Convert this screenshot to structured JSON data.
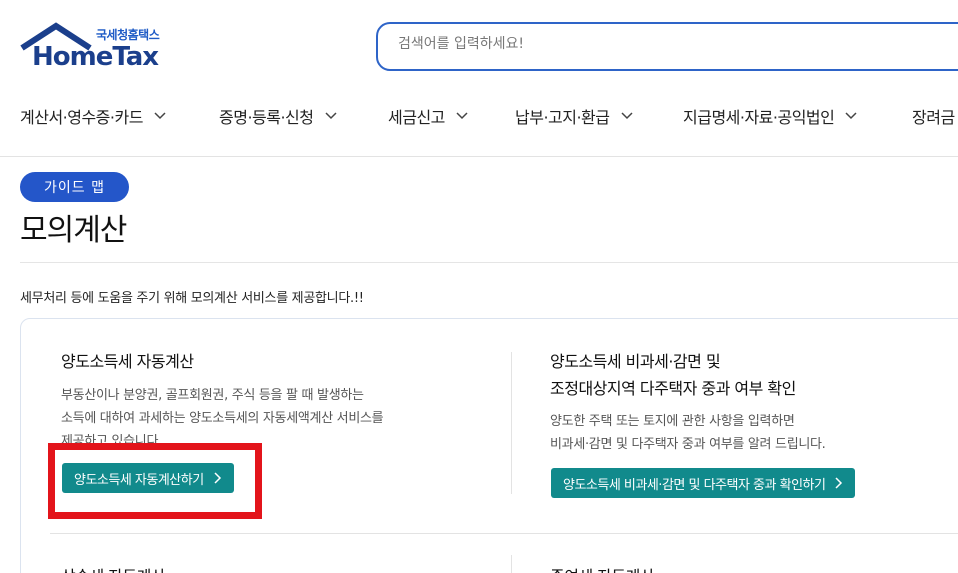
{
  "brand": {
    "sub": "국세청홈택스",
    "name": "HomeTax",
    "color_primary": "#1b3f8c",
    "color_accent": "#1e5bc6"
  },
  "search": {
    "placeholder": "검색어를 입력하세요!"
  },
  "gnb": {
    "items": [
      {
        "label": "계산서·영수증·카드"
      },
      {
        "label": "증명·등록·신청"
      },
      {
        "label": "세금신고"
      },
      {
        "label": "납부·고지·환급"
      },
      {
        "label": "지급명세·자료·공익법인"
      },
      {
        "label": "장려금"
      }
    ]
  },
  "page": {
    "badge": "가이드 맵",
    "title": "모의계산",
    "description": "세무처리 등에 도움을 주기 위해 모의계산 서비스를 제공합니다.!!"
  },
  "services": [
    {
      "title_lines": [
        "양도소득세 자동계산"
      ],
      "text_lines": [
        "부동산이나 분양권, 골프회원권, 주식 등을 팔 때 발생하는",
        "소득에 대하여 과세하는 양도소득세의 자동세액계산 서비스를",
        "제공하고 있습니다."
      ],
      "button": "양도소득세 자동계산하기"
    },
    {
      "title_lines": [
        "양도소득세 비과세·감면 및",
        "조정대상지역 다주택자 중과 여부 확인"
      ],
      "text_lines": [
        "양도한 주택 또는 토지에 관한 사항을 입력하면",
        "비과세·감면 및 다주택자 중과 여부를 알려 드립니다."
      ],
      "button": "양도소득세 비과세·감면 및 다주택자 중과 확인하기"
    }
  ],
  "next_row": {
    "left_title": "상속세 자동계산",
    "right_title": "증여세 자동계산"
  },
  "colors": {
    "badge": "#2456c9",
    "button": "#118a8c",
    "highlight": "#e3141b"
  }
}
